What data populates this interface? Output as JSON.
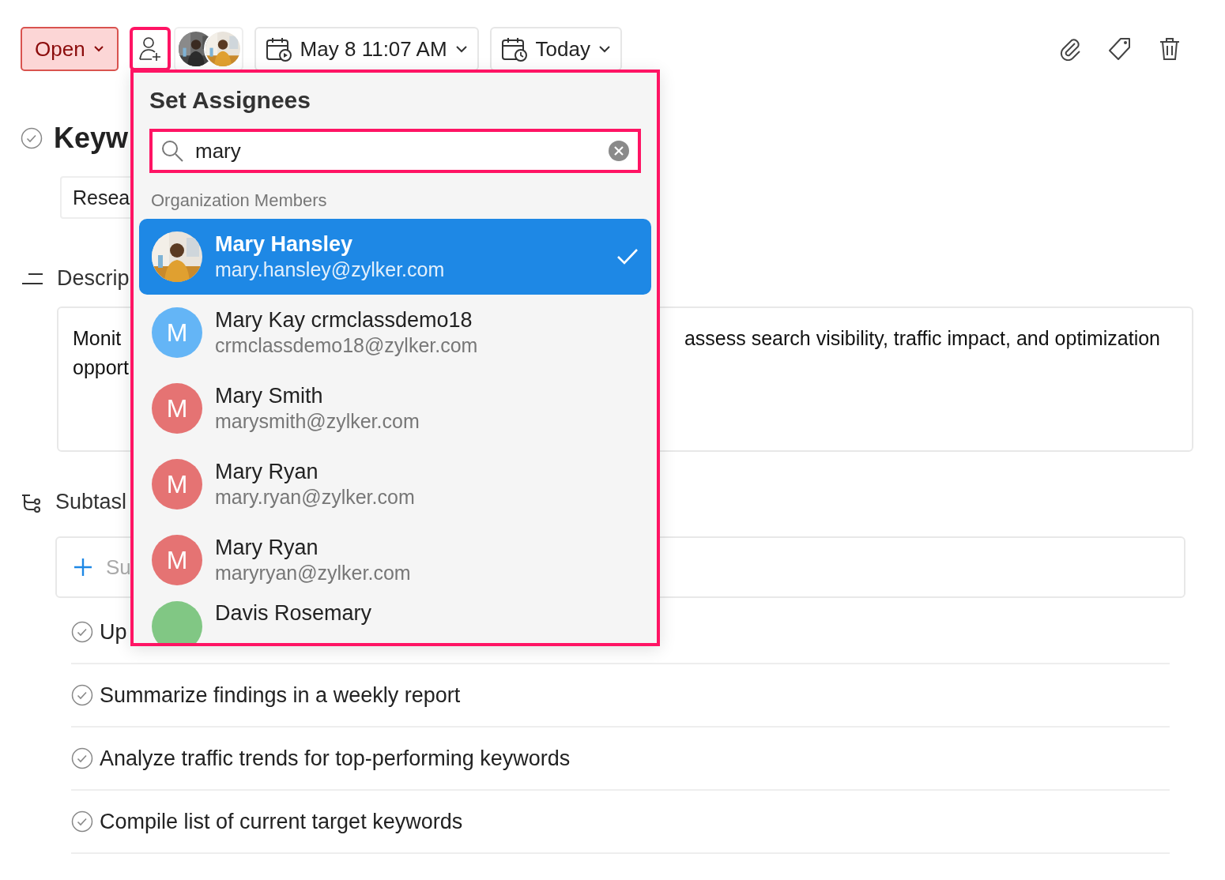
{
  "toolbar": {
    "status": {
      "label": "Open"
    },
    "assign_button": {
      "highlighted": true
    },
    "due_date": {
      "label": "May 8 11:07 AM"
    },
    "reminder": {
      "label": "Today"
    }
  },
  "task": {
    "title": "Keyw",
    "completed": false,
    "tags": [
      {
        "label": "Resea"
      }
    ]
  },
  "description": {
    "heading": "Descrip",
    "text_left": [
      "Monit",
      "opport"
    ],
    "text_right": "assess search visibility, traffic impact, and optimization"
  },
  "subtasks": {
    "heading": "Subtasl",
    "add_placeholder": "Su",
    "items": [
      {
        "title": "Up",
        "completed": false
      },
      {
        "title": "Summarize findings in a weekly report",
        "completed": false
      },
      {
        "title": "Analyze traffic trends for top-performing keywords",
        "completed": false
      },
      {
        "title": "Compile list of current target keywords",
        "completed": false
      }
    ]
  },
  "assignee_popover": {
    "title": "Set Assignees",
    "highlighted": true,
    "search": {
      "value": "mary",
      "highlighted": true
    },
    "section": "Organization Members",
    "members": [
      {
        "name": "Mary Hansley",
        "email": "mary.hansley@zylker.com",
        "kind": "picture",
        "selected": true
      },
      {
        "name": "Mary Kay crmclassdemo18",
        "email": "crmclassdemo18@zylker.com",
        "kind": "initial",
        "initial": "M",
        "color": "#64b5f6",
        "selected": false
      },
      {
        "name": "Mary Smith",
        "email": "marysmith@zylker.com",
        "kind": "initial",
        "initial": "M",
        "color": "#e57373",
        "selected": false
      },
      {
        "name": "Mary Ryan",
        "email": "mary.ryan@zylker.com",
        "kind": "initial",
        "initial": "M",
        "color": "#e57373",
        "selected": false
      },
      {
        "name": "Mary Ryan",
        "email": "maryryan@zylker.com",
        "kind": "initial",
        "initial": "M",
        "color": "#e57373",
        "selected": false
      },
      {
        "name": "Davis Rosemary",
        "kind": "initial",
        "color": "#81c784",
        "selected": false
      }
    ]
  }
}
